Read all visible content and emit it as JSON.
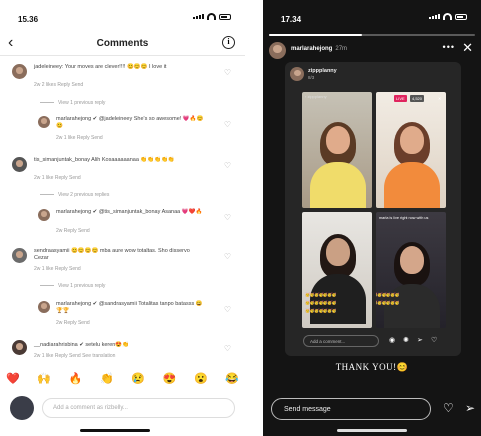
{
  "left": {
    "status_time": "15.36",
    "header": {
      "back": "‹",
      "title": "Comments",
      "info": "i"
    },
    "comments": [
      {
        "text": "jadeleineey: Your moves are clever!!!! 😊😊😊 I love it",
        "meta": "2w   2 likes   Reply   Send",
        "view_more": "View 1 previous reply"
      },
      {
        "text": "marlarahejong ✔ @jadeleineey She's so awesome! 💗🔥😊😊",
        "meta": "2w   1 like   Reply   Send"
      },
      {
        "text": "tis_simanjuntak_bonay Alih Kosaaaaaanaa 👏👏👏👏👏",
        "meta": "2w   1 like   Reply   Send",
        "view_more": "View 2 previous replies"
      },
      {
        "text": "marlarahejong ✔ @tis_simanjuntak_bonay Asanaa 💗❤️🔥",
        "meta": "2w   Reply   Send"
      },
      {
        "text": "sendraasyamii 😊😊😊😊 mba aure wow totaltas. Sho disservo Cezar",
        "meta": "2w   1 like   Reply   Send",
        "view_more": "View 1 previous reply"
      },
      {
        "text": "marlarahejong ✔ @sandrasyamii Totalitas tanpo batasss 😀🏆🏆",
        "meta": "2w   Reply   Send"
      },
      {
        "text": "__nadiarahrisbina ✔ setelu keren😍👏",
        "meta": "2w   1 like   Reply   Send   See translation"
      }
    ],
    "emoji_bar": [
      "❤️",
      "🙌",
      "🔥",
      "👏",
      "😢",
      "😍",
      "😮",
      "😂"
    ],
    "input_placeholder": "Add a comment as rizbelly..."
  },
  "right": {
    "status_time": "17.34",
    "header": {
      "username": "marlarahejong",
      "age": "27m",
      "more": "•••",
      "close": "✕"
    },
    "progress": 0.45,
    "card": {
      "username": "zippplanny",
      "age": "8/3",
      "live_badge": "LIVE",
      "viewers": "4,520",
      "overlay_text": "marla is live right now with us",
      "emoji_rows": [
        "🥳🥳🥳🥳🥳🥳🥳",
        "🥳🥳🥳🥳🥳🥳🥳",
        "🥳🥳🥳🥳🥳🥳🥳"
      ],
      "comment_placeholder": "Add a comment..."
    },
    "caption": "THANK YOU!😊",
    "send_placeholder": "Send message"
  }
}
